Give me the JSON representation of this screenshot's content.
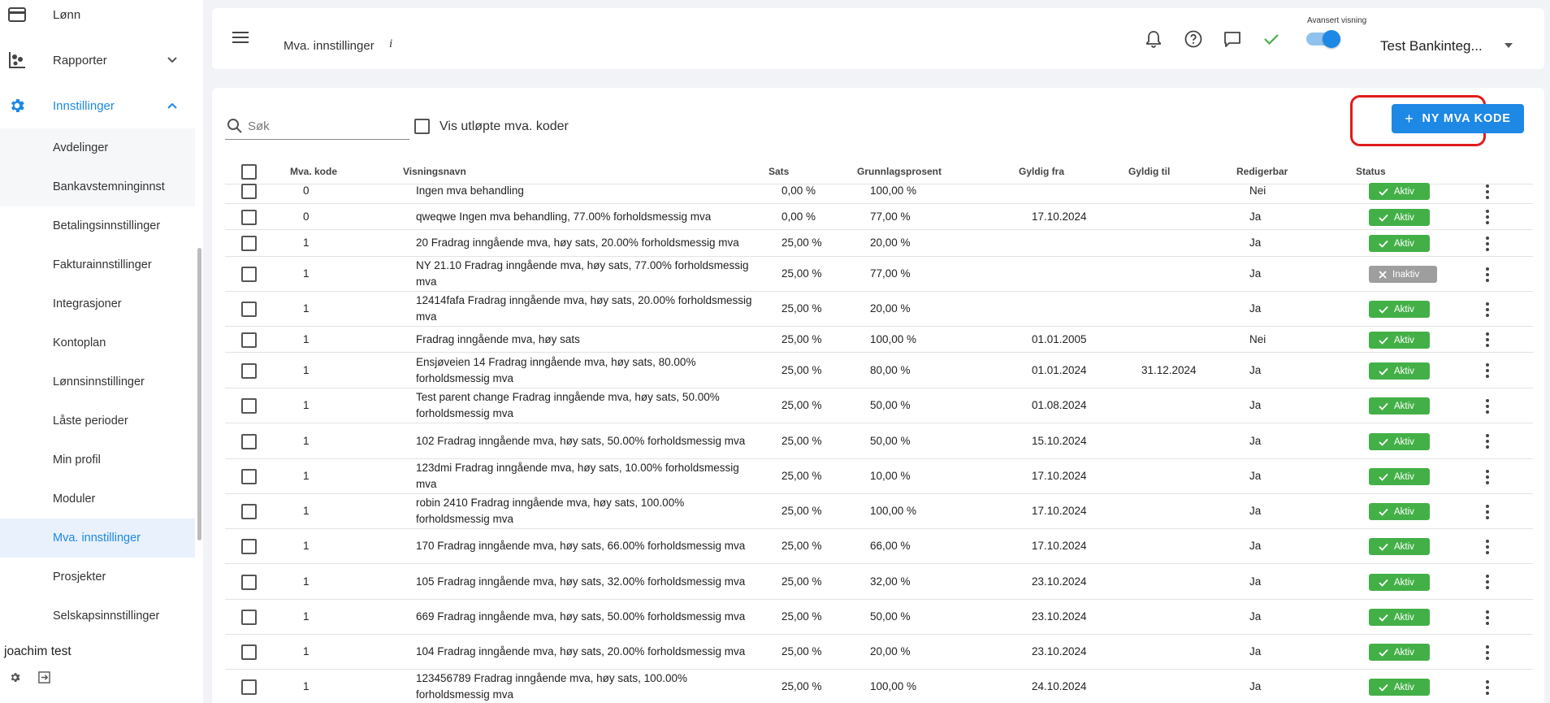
{
  "sidebar": {
    "items": [
      {
        "label": "Lønn",
        "icon": "wallet-icon"
      },
      {
        "label": "Rapporter",
        "icon": "reports-icon"
      },
      {
        "label": "Innstillinger",
        "icon": "gear-icon"
      }
    ],
    "sub_items": [
      "Avdelinger",
      "Bankavstemninginnst",
      "Betalingsinnstillinger",
      "Fakturainnstillinger",
      "Integrasjoner",
      "Kontoplan",
      "Lønnsinnstillinger",
      "Låste perioder",
      "Min profil",
      "Moduler",
      "Mva. innstillinger",
      "Prosjekter",
      "Selskapsinnstillinger"
    ],
    "user_name": "joachim test"
  },
  "header": {
    "title": "Mva. innstillinger",
    "info": "i",
    "advanced_label": "Avansert visning",
    "company": "Test Bankinteg..."
  },
  "toolbar": {
    "search_placeholder": "Søk",
    "show_expired_label": "Vis utløpte mva. koder",
    "new_button_label": "NY MVA KODE"
  },
  "table": {
    "headers": [
      "Mva. kode",
      "Visningsnavn",
      "Sats",
      "Grunnlagsprosent",
      "Gyldig fra",
      "Gyldig til",
      "Redigerbar",
      "Status"
    ],
    "rows": [
      {
        "kode": "0",
        "navn": "Ingen mva behandling",
        "sats": "0,00 %",
        "grunnlag": "100,00 %",
        "fra": "",
        "til": "",
        "redigerbar": "Nei",
        "status": "Aktiv"
      },
      {
        "kode": "0",
        "navn": "qweqwe Ingen mva behandling, 77.00% forholdsmessig mva",
        "sats": "0,00 %",
        "grunnlag": "77,00 %",
        "fra": "17.10.2024",
        "til": "",
        "redigerbar": "Ja",
        "status": "Aktiv"
      },
      {
        "kode": "1",
        "navn": "20 Fradrag inngående mva, høy sats, 20.00% forholdsmessig mva",
        "sats": "25,00 %",
        "grunnlag": "20,00 %",
        "fra": "",
        "til": "",
        "redigerbar": "Ja",
        "status": "Aktiv"
      },
      {
        "kode": "1",
        "navn": "NY 21.10 Fradrag inngående mva, høy sats, 77.00% forholdsmessig mva",
        "sats": "25,00 %",
        "grunnlag": "77,00 %",
        "fra": "",
        "til": "",
        "redigerbar": "Ja",
        "status": "Inaktiv"
      },
      {
        "kode": "1",
        "navn": "12414fafa Fradrag inngående mva, høy sats, 20.00% forholdsmessig mva",
        "sats": "25,00 %",
        "grunnlag": "20,00 %",
        "fra": "",
        "til": "",
        "redigerbar": "Ja",
        "status": "Aktiv"
      },
      {
        "kode": "1",
        "navn": "Fradrag inngående mva, høy sats",
        "sats": "25,00 %",
        "grunnlag": "100,00 %",
        "fra": "01.01.2005",
        "til": "",
        "redigerbar": "Nei",
        "status": "Aktiv"
      },
      {
        "kode": "1",
        "navn": "Ensjøveien 14 Fradrag inngående mva, høy sats, 80.00% forholdsmessig mva",
        "sats": "25,00 %",
        "grunnlag": "80,00 %",
        "fra": "01.01.2024",
        "til": "31.12.2024",
        "redigerbar": "Ja",
        "status": "Aktiv"
      },
      {
        "kode": "1",
        "navn": "Test parent change Fradrag inngående mva, høy sats, 50.00% forholdsmessig mva",
        "sats": "25,00 %",
        "grunnlag": "50,00 %",
        "fra": "01.08.2024",
        "til": "",
        "redigerbar": "Ja",
        "status": "Aktiv"
      },
      {
        "kode": "1",
        "navn": "102 Fradrag inngående mva, høy sats, 50.00% forholdsmessig mva",
        "sats": "25,00 %",
        "grunnlag": "50,00 %",
        "fra": "15.10.2024",
        "til": "",
        "redigerbar": "Ja",
        "status": "Aktiv"
      },
      {
        "kode": "1",
        "navn": "123dmi Fradrag inngående mva, høy sats, 10.00% forholdsmessig mva",
        "sats": "25,00 %",
        "grunnlag": "10,00 %",
        "fra": "17.10.2024",
        "til": "",
        "redigerbar": "Ja",
        "status": "Aktiv"
      },
      {
        "kode": "1",
        "navn": "robin 2410 Fradrag inngående mva, høy sats, 100.00% forholdsmessig mva",
        "sats": "25,00 %",
        "grunnlag": "100,00 %",
        "fra": "17.10.2024",
        "til": "",
        "redigerbar": "Ja",
        "status": "Aktiv"
      },
      {
        "kode": "1",
        "navn": "170 Fradrag inngående mva, høy sats, 66.00% forholdsmessig mva",
        "sats": "25,00 %",
        "grunnlag": "66,00 %",
        "fra": "17.10.2024",
        "til": "",
        "redigerbar": "Ja",
        "status": "Aktiv"
      },
      {
        "kode": "1",
        "navn": "105 Fradrag inngående mva, høy sats, 32.00% forholdsmessig mva",
        "sats": "25,00 %",
        "grunnlag": "32,00 %",
        "fra": "23.10.2024",
        "til": "",
        "redigerbar": "Ja",
        "status": "Aktiv"
      },
      {
        "kode": "1",
        "navn": "669 Fradrag inngående mva, høy sats, 50.00% forholdsmessig mva",
        "sats": "25,00 %",
        "grunnlag": "50,00 %",
        "fra": "23.10.2024",
        "til": "",
        "redigerbar": "Ja",
        "status": "Aktiv"
      },
      {
        "kode": "1",
        "navn": "104 Fradrag inngående mva, høy sats, 20.00% forholdsmessig mva",
        "sats": "25,00 %",
        "grunnlag": "20,00 %",
        "fra": "23.10.2024",
        "til": "",
        "redigerbar": "Ja",
        "status": "Aktiv"
      },
      {
        "kode": "1",
        "navn": "123456789 Fradrag inngående mva, høy sats, 100.00% forholdsmessig mva",
        "sats": "25,00 %",
        "grunnlag": "100,00 %",
        "fra": "24.10.2024",
        "til": "",
        "redigerbar": "Ja",
        "status": "Aktiv"
      }
    ]
  },
  "colors": {
    "accent": "#1e88e5",
    "status_active": "#43b047",
    "status_inactive": "#9e9e9e",
    "highlight": "#e01c1c"
  }
}
